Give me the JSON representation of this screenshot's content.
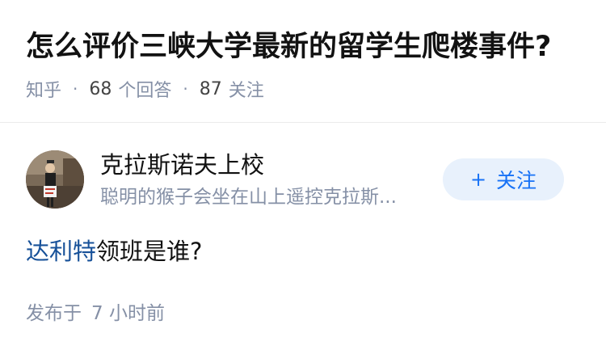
{
  "question": {
    "title": "怎么评价三峡大学最新的留学生爬楼事件?",
    "source": "知乎",
    "answers_count": "68",
    "answers_label": "个回答",
    "followers_count": "87",
    "followers_label": "关注",
    "separator": "·"
  },
  "author": {
    "name": "克拉斯诺夫上校",
    "bio": "聪明的猴子会坐在山上遥控克拉斯...",
    "avatar_icon": "user-avatar"
  },
  "follow_button": {
    "plus": "+",
    "label": "关注"
  },
  "answer": {
    "link_text": "达利特",
    "rest_text": "领班是谁?"
  },
  "post": {
    "prefix": "发布于",
    "time": "7 小时前"
  },
  "colors": {
    "link": "#175199",
    "accent": "#1772f6",
    "muted": "#8590a6"
  }
}
